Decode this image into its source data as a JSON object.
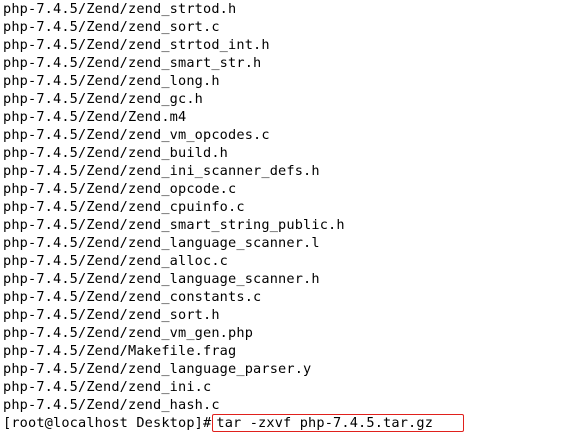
{
  "terminal": {
    "lines": [
      "php-7.4.5/Zend/zend_strtod.h",
      "php-7.4.5/Zend/zend_sort.c",
      "php-7.4.5/Zend/zend_strtod_int.h",
      "php-7.4.5/Zend/zend_smart_str.h",
      "php-7.4.5/Zend/zend_long.h",
      "php-7.4.5/Zend/zend_gc.h",
      "php-7.4.5/Zend/Zend.m4",
      "php-7.4.5/Zend/zend_vm_opcodes.c",
      "php-7.4.5/Zend/zend_build.h",
      "php-7.4.5/Zend/zend_ini_scanner_defs.h",
      "php-7.4.5/Zend/zend_opcode.c",
      "php-7.4.5/Zend/zend_cpuinfo.c",
      "php-7.4.5/Zend/zend_smart_string_public.h",
      "php-7.4.5/Zend/zend_language_scanner.l",
      "php-7.4.5/Zend/zend_alloc.c",
      "php-7.4.5/Zend/zend_language_scanner.h",
      "php-7.4.5/Zend/zend_constants.c",
      "php-7.4.5/Zend/zend_sort.h",
      "php-7.4.5/Zend/zend_vm_gen.php",
      "php-7.4.5/Zend/Makefile.frag",
      "php-7.4.5/Zend/zend_language_parser.y",
      "php-7.4.5/Zend/zend_ini.c",
      "php-7.4.5/Zend/zend_hash.c"
    ],
    "prompt": "[root@localhost Desktop]#",
    "command": "tar -zxvf php-7.4.5.tar.gz",
    "highlight_color": "#e0201c"
  }
}
